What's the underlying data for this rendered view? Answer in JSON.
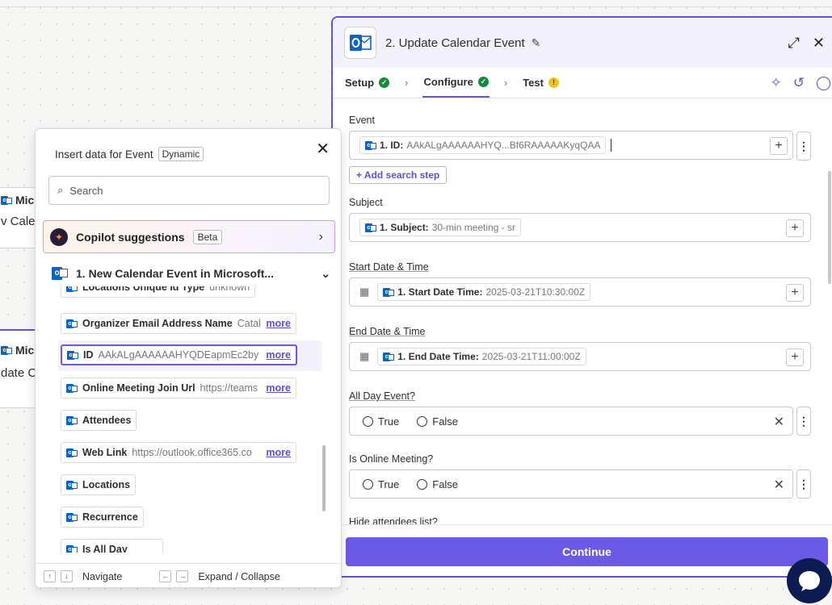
{
  "background_cards": [
    {
      "line1": "Micro",
      "line2": "v Caler"
    },
    {
      "line1": "Micro",
      "line2": "date C"
    }
  ],
  "editor": {
    "title": "2. Update Calendar Event",
    "tabs": [
      {
        "label": "Setup",
        "status": "ok"
      },
      {
        "label": "Configure",
        "status": "ok"
      },
      {
        "label": "Test",
        "status": "warning"
      }
    ],
    "fields": {
      "event": {
        "label": "Event",
        "pill_key": "1. ID:",
        "pill_value": "AAkALgAAAAAAHYQ...Bf6RAAAAAKyqQAA",
        "add_search_label": "+ Add search step"
      },
      "subject": {
        "label": "Subject",
        "pill_key": "1. Subject:",
        "pill_value": "30-min meeting - sr"
      },
      "start": {
        "label": "Start Date & Time",
        "pill_key": "1. Start Date Time:",
        "pill_value": "2025-03-21T10:30:00Z"
      },
      "end": {
        "label": "End Date & Time",
        "pill_key": "1. End Date Time:",
        "pill_value": "2025-03-21T11:00:00Z"
      },
      "all_day": {
        "label": "All Day Event?",
        "opt_true": "True",
        "opt_false": "False"
      },
      "online": {
        "label": "Is Online Meeting?",
        "opt_true": "True",
        "opt_false": "False"
      },
      "hide": {
        "label": "Hide attendees list?"
      }
    },
    "continue_label": "Continue"
  },
  "popup": {
    "title": "Insert data for Event",
    "badge": "Dynamic",
    "search_placeholder": "Search",
    "copilot": {
      "label": "Copilot suggestions",
      "badge": "Beta"
    },
    "group": {
      "label": "1.  New Calendar Event in Microsoft..."
    },
    "items": [
      {
        "key": "Locations Unique Id Type",
        "value": "unknown",
        "more": ""
      },
      {
        "key": "Organizer Email Address Name",
        "value": "Catal",
        "more": "more"
      },
      {
        "key": "ID",
        "value": "AAkALgAAAAAAHYQDEapmEc2by",
        "more": "more"
      },
      {
        "key": "Online Meeting Join Url",
        "value": "https://teams",
        "more": "more"
      },
      {
        "key": "Attendees",
        "value": "",
        "more": ""
      },
      {
        "key": "Web Link",
        "value": "https://outlook.office365.co",
        "more": "more"
      },
      {
        "key": "Locations",
        "value": "",
        "more": ""
      },
      {
        "key": "Recurrence",
        "value": "",
        "more": ""
      },
      {
        "key": "Is All Day",
        "value": "false",
        "more": ""
      }
    ],
    "footer": {
      "navigate": "Navigate",
      "expand": "Expand / Collapse"
    }
  },
  "icons": {
    "app": "outlook-icon",
    "edit": "pencil-icon",
    "expand": "expand-icon",
    "close": "close-icon",
    "copilot": "copilot-icon",
    "chat": "chat-bubble-icon"
  },
  "colors": {
    "accent": "#6154d6",
    "button": "#6a5ae6",
    "success": "#138a3d",
    "warning": "#f0c419",
    "outlook": "#0a64c2"
  }
}
